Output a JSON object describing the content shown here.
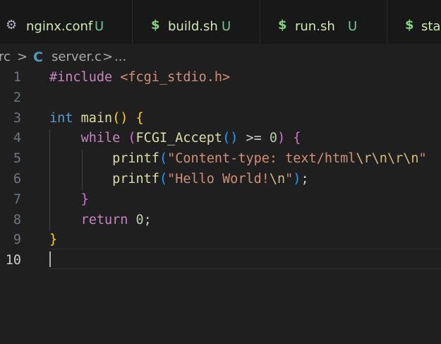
{
  "tabs": [
    {
      "icon": "gear-icon",
      "glyph": "⚙",
      "name": "nginx.conf",
      "status": "U"
    },
    {
      "icon": "dollar-icon",
      "glyph": "$",
      "name": "build.sh",
      "status": "U"
    },
    {
      "icon": "dollar-icon",
      "glyph": "$",
      "name": "run.sh",
      "status": "U"
    },
    {
      "icon": "dollar-icon",
      "glyph": "$",
      "name": "star",
      "status": ""
    }
  ],
  "breadcrumb": {
    "folder": "rc",
    "sep1": ">",
    "file_icon": "C",
    "file": "server.c",
    "sep2": ">",
    "ellipsis": "..."
  },
  "editor": {
    "active_line": 10,
    "lines": [
      {
        "num": "1",
        "tokens": [
          {
            "t": "#include",
            "c": "t-pre"
          },
          {
            "t": " ",
            "c": "t-plain"
          },
          {
            "t": "<fcgi_stdio.h>",
            "c": "t-str"
          }
        ]
      },
      {
        "num": "2",
        "tokens": []
      },
      {
        "num": "3",
        "tokens": [
          {
            "t": "int",
            "c": "t-type"
          },
          {
            "t": " ",
            "c": "t-plain"
          },
          {
            "t": "main",
            "c": "t-fn"
          },
          {
            "t": "()",
            "c": "t-b1"
          },
          {
            "t": " ",
            "c": "t-plain"
          },
          {
            "t": "{",
            "c": "t-b1"
          }
        ]
      },
      {
        "num": "4",
        "tokens": [
          {
            "t": "    ",
            "c": "t-plain"
          },
          {
            "t": "while",
            "c": "t-kw"
          },
          {
            "t": " ",
            "c": "t-plain"
          },
          {
            "t": "(",
            "c": "t-b2"
          },
          {
            "t": "FCGI_Accept",
            "c": "t-fn"
          },
          {
            "t": "()",
            "c": "t-b3"
          },
          {
            "t": " >= ",
            "c": "t-plain"
          },
          {
            "t": "0",
            "c": "t-num"
          },
          {
            "t": ")",
            "c": "t-b2"
          },
          {
            "t": " ",
            "c": "t-plain"
          },
          {
            "t": "{",
            "c": "t-b2"
          }
        ]
      },
      {
        "num": "5",
        "tokens": [
          {
            "t": "        ",
            "c": "t-plain"
          },
          {
            "t": "printf",
            "c": "t-fn"
          },
          {
            "t": "(",
            "c": "t-b3"
          },
          {
            "t": "\"Content-type: text/html",
            "c": "t-str"
          },
          {
            "t": "\\r\\n\\r\\n",
            "c": "t-esc"
          },
          {
            "t": "\"",
            "c": "t-str"
          }
        ]
      },
      {
        "num": "6",
        "tokens": [
          {
            "t": "        ",
            "c": "t-plain"
          },
          {
            "t": "printf",
            "c": "t-fn"
          },
          {
            "t": "(",
            "c": "t-b3"
          },
          {
            "t": "\"Hello World!",
            "c": "t-str"
          },
          {
            "t": "\\n",
            "c": "t-esc"
          },
          {
            "t": "\"",
            "c": "t-str"
          },
          {
            "t": ")",
            "c": "t-b3"
          },
          {
            "t": ";",
            "c": "t-plain"
          }
        ]
      },
      {
        "num": "7",
        "tokens": [
          {
            "t": "    ",
            "c": "t-plain"
          },
          {
            "t": "}",
            "c": "t-b2"
          }
        ]
      },
      {
        "num": "8",
        "tokens": [
          {
            "t": "    ",
            "c": "t-plain"
          },
          {
            "t": "return",
            "c": "t-kw"
          },
          {
            "t": " ",
            "c": "t-plain"
          },
          {
            "t": "0",
            "c": "t-num"
          },
          {
            "t": ";",
            "c": "t-plain"
          }
        ]
      },
      {
        "num": "9",
        "tokens": [
          {
            "t": "}",
            "c": "t-b1"
          }
        ]
      },
      {
        "num": "10",
        "tokens": []
      }
    ]
  }
}
